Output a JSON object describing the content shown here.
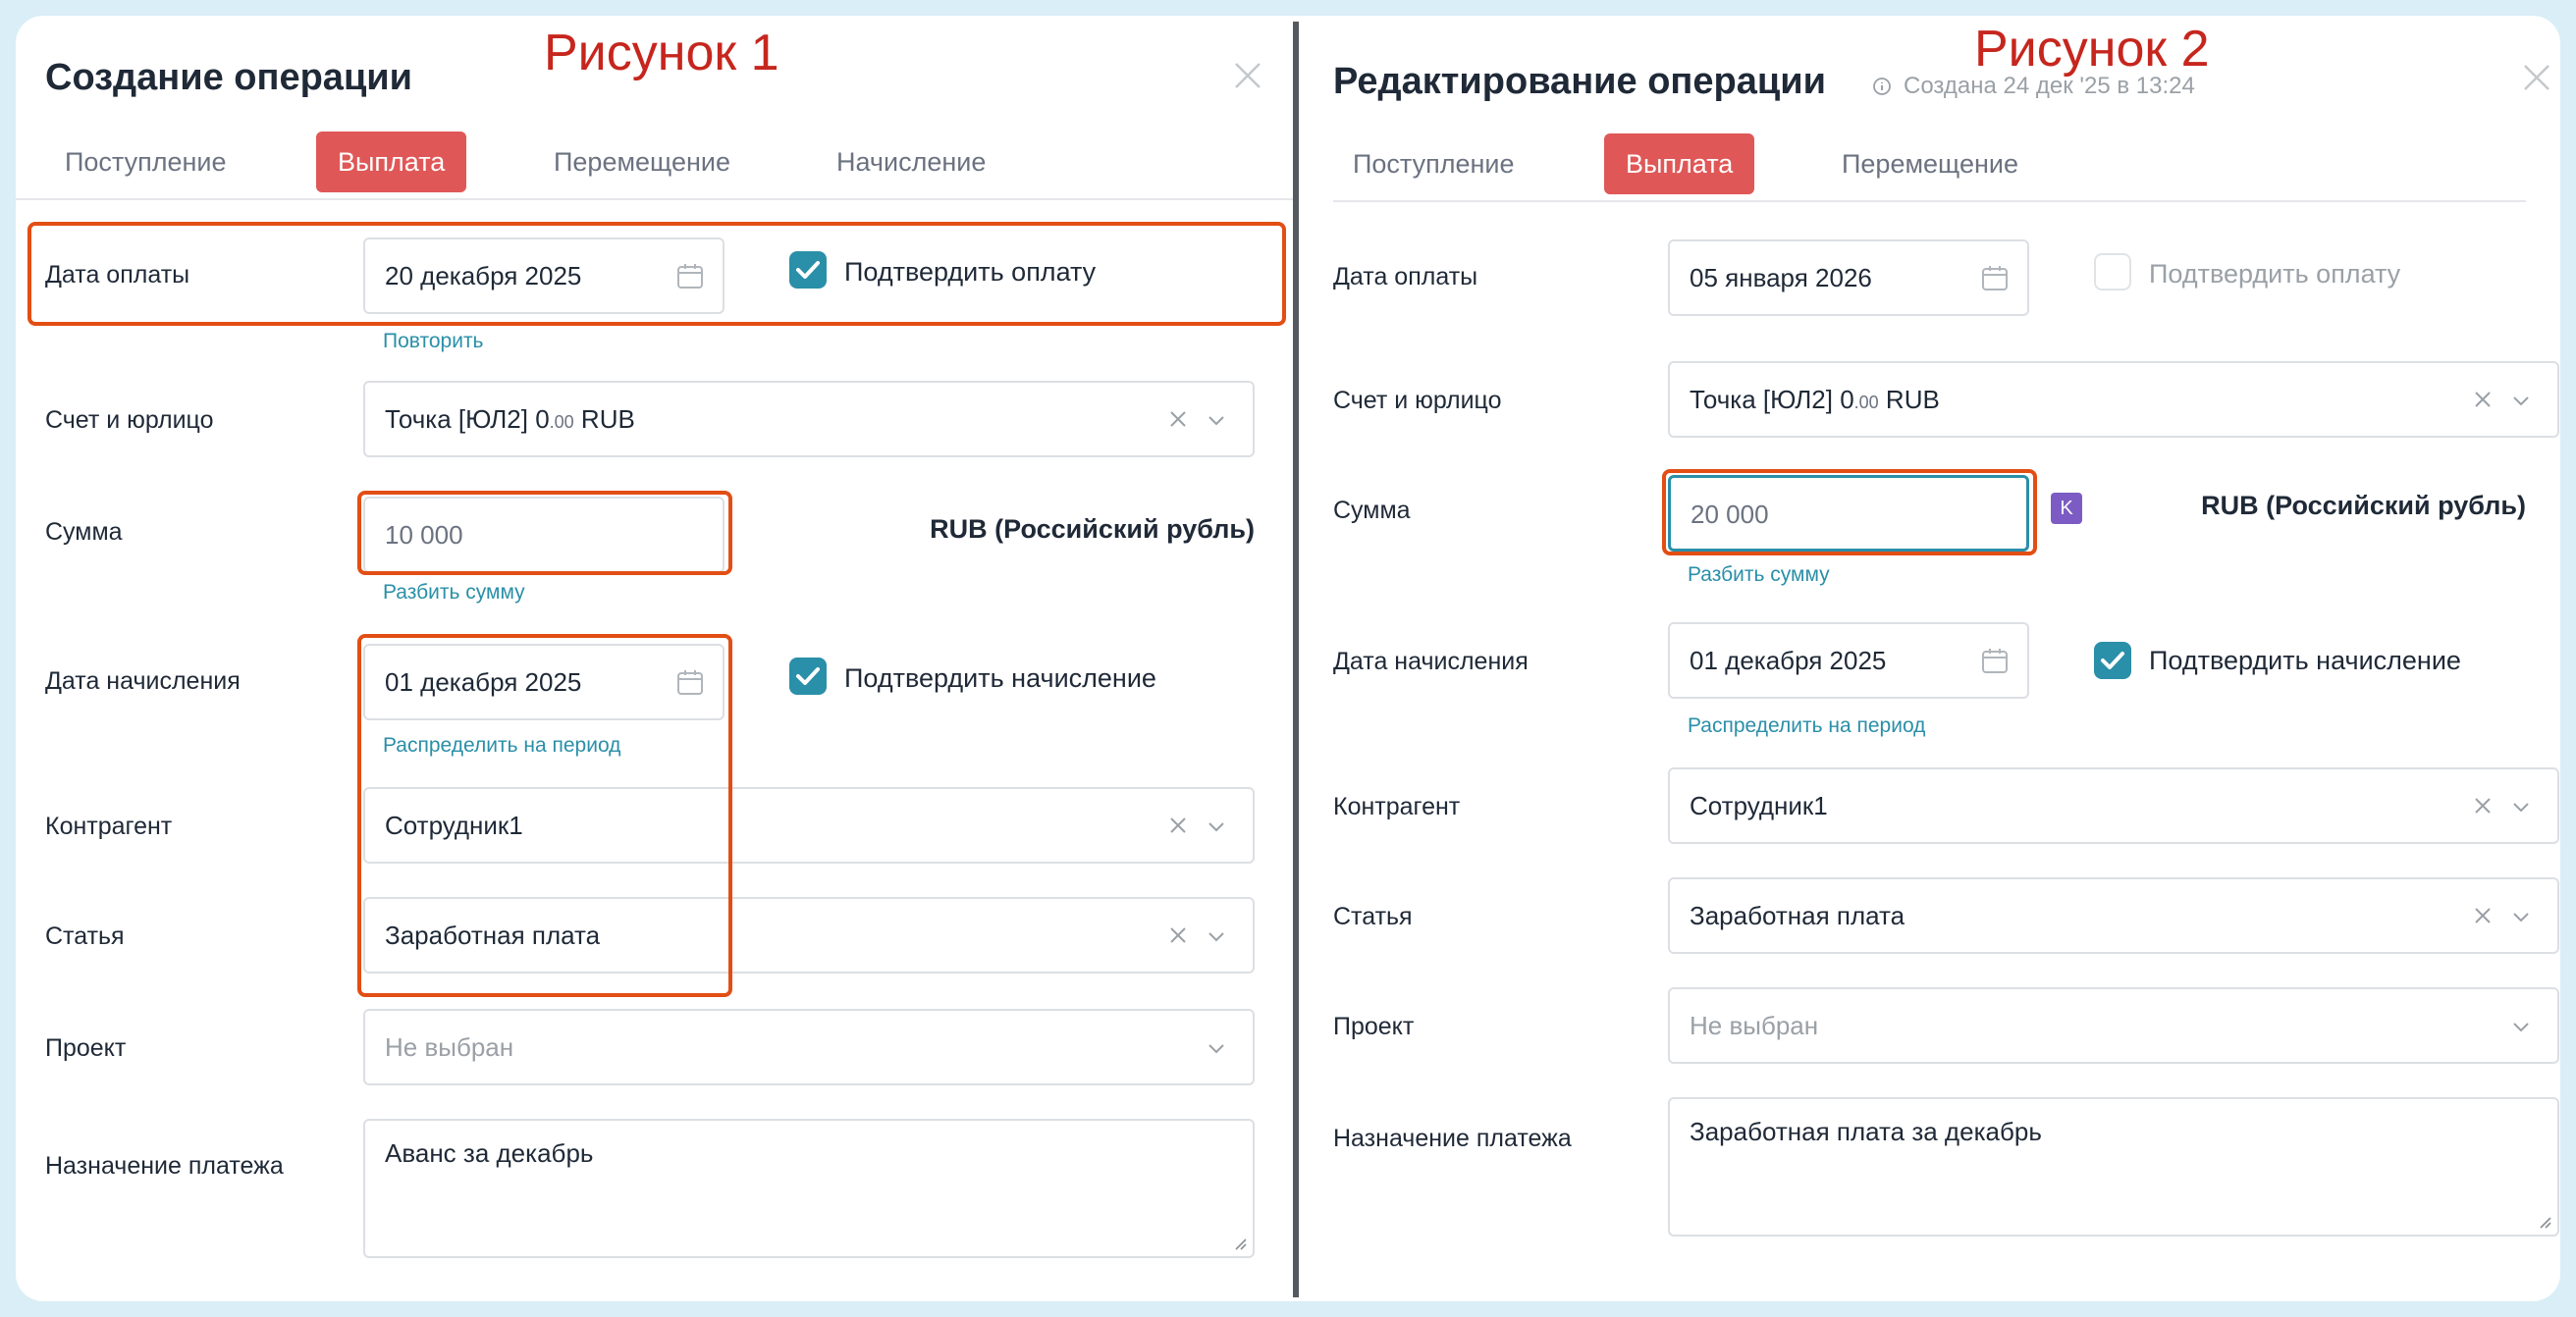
{
  "figure1": {
    "label": "Рисунок 1",
    "title": "Создание операции",
    "tabs": [
      "Поступление",
      "Выплата",
      "Перемещение",
      "Начисление"
    ],
    "active_tab": "Выплата",
    "payment_date": {
      "label": "Дата оплаты",
      "value": "20 декабря 2025",
      "repeat_link": "Повторить",
      "confirm_label": "Подтвердить оплату",
      "confirmed": true
    },
    "account": {
      "label": "Счет и юрлицо",
      "value_main": "Точка [ЮЛ2] 0",
      "value_cents": ".00",
      "value_currency": " RUB"
    },
    "amount": {
      "label": "Сумма",
      "value": "10 000",
      "split_link": "Разбить сумму",
      "currency": "RUB (Российский рубль)"
    },
    "accrual_date": {
      "label": "Дата начисления",
      "value": "01 декабря 2025",
      "distribute_link": "Распределить на период",
      "confirm_label": "Подтвердить начисление",
      "confirmed": true
    },
    "counterparty": {
      "label": "Контрагент",
      "value": "Сотрудник1"
    },
    "article": {
      "label": "Статья",
      "value": "Заработная плата"
    },
    "project": {
      "label": "Проект",
      "placeholder": "Не выбран"
    },
    "purpose": {
      "label": "Назначение платежа",
      "value": "Аванс за декабрь"
    }
  },
  "figure2": {
    "label": "Рисунок 2",
    "title": "Редактирование операции",
    "created": "Создана 24 дек '25 в 13:24",
    "tabs": [
      "Поступление",
      "Выплата",
      "Перемещение"
    ],
    "active_tab": "Выплата",
    "payment_date": {
      "label": "Дата оплаты",
      "value": "05 января 2026",
      "confirm_label": "Подтвердить оплату",
      "confirmed": false
    },
    "account": {
      "label": "Счет и юрлицо",
      "value_main": "Точка [ЮЛ2] 0",
      "value_cents": ".00",
      "value_currency": " RUB"
    },
    "amount": {
      "label": "Сумма",
      "value": "20 000",
      "badge": "K",
      "split_link": "Разбить сумму",
      "currency": "RUB (Российский рубль)"
    },
    "accrual_date": {
      "label": "Дата начисления",
      "value": "01 декабря 2025",
      "distribute_link": "Распределить на период",
      "confirm_label": "Подтвердить начисление",
      "confirmed": true
    },
    "counterparty": {
      "label": "Контрагент",
      "value": "Сотрудник1"
    },
    "article": {
      "label": "Статья",
      "value": "Заработная плата"
    },
    "project": {
      "label": "Проект",
      "placeholder": "Не выбран"
    },
    "purpose": {
      "label": "Назначение платежа",
      "value": "Заработная плата за декабрь"
    }
  },
  "colors": {
    "accent": "#2a8fa8",
    "active_tab": "#e05757",
    "highlight": "#e24e14",
    "figure_label": "#c6261d",
    "k_badge": "#7c5cc4"
  },
  "icons": [
    "close-icon",
    "calendar-icon",
    "clear-x-icon",
    "chevron-down-icon",
    "checkmark-icon",
    "info-icon",
    "resize-grip-icon"
  ]
}
